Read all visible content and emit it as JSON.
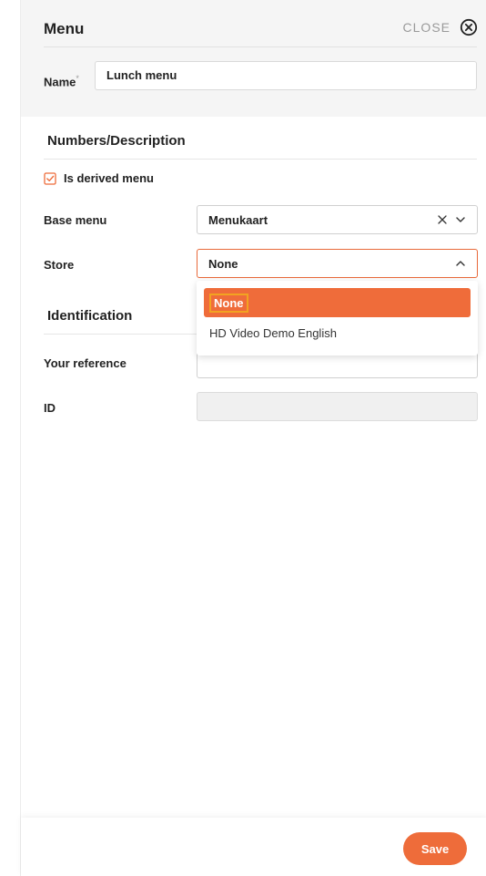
{
  "header": {
    "title": "Menu",
    "close_label": "CLOSE",
    "close_icon": "circle-x-icon"
  },
  "name_field": {
    "label": "Name",
    "required_marker": "*",
    "value": "Lunch menu"
  },
  "sections": {
    "numbers": {
      "title": "Numbers/Description",
      "derived_checkbox": {
        "label": "Is derived menu",
        "checked": true
      },
      "base_menu": {
        "label": "Base menu",
        "value": "Menukaart"
      },
      "store": {
        "label": "Store",
        "value": "None",
        "open": true,
        "options": [
          "None",
          "HD Video Demo English"
        ],
        "selected_index": 0
      }
    },
    "identification": {
      "title": "Identification",
      "your_reference": {
        "label": "Your reference",
        "value": ""
      },
      "id": {
        "label": "ID",
        "value": ""
      }
    }
  },
  "footer": {
    "save_label": "Save"
  },
  "colors": {
    "accent": "#ee6c3a",
    "focus_outline": "#f2a321"
  }
}
